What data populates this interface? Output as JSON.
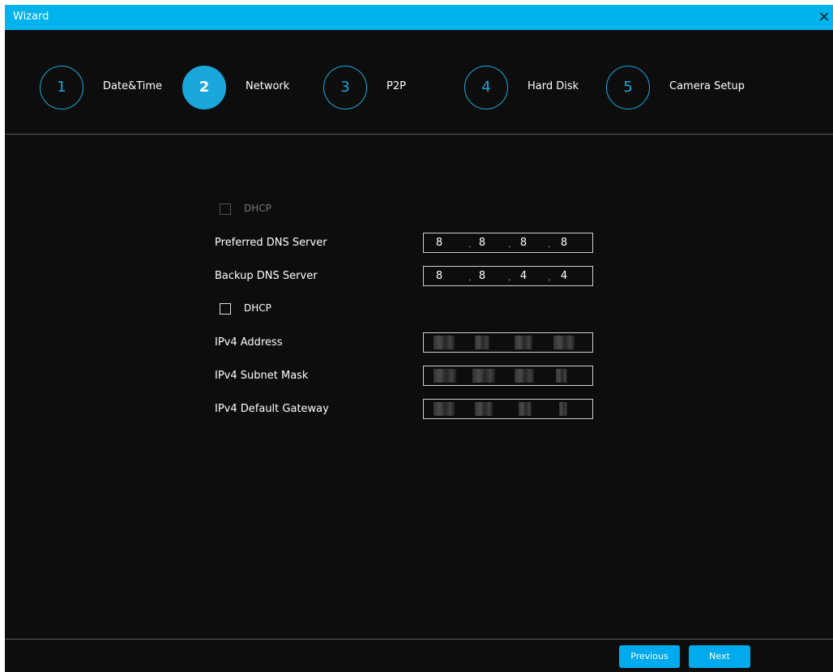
{
  "window": {
    "title": "Wizard",
    "close_glyph": "×"
  },
  "steps": [
    {
      "number": "1",
      "label": "Date&Time",
      "active": false
    },
    {
      "number": "2",
      "label": "Network",
      "active": true
    },
    {
      "number": "3",
      "label": "P2P",
      "active": false
    },
    {
      "number": "4",
      "label": "Hard Disk",
      "active": false
    },
    {
      "number": "5",
      "label": "Camera Setup",
      "active": false
    }
  ],
  "dns": {
    "dhcp_label": "DHCP",
    "dhcp_checked": false,
    "dhcp_disabled": true,
    "preferred_label": "Preferred DNS Server",
    "preferred": [
      "8",
      "8",
      "8",
      "8"
    ],
    "backup_label": "Backup DNS Server",
    "backup": [
      "8",
      "8",
      "4",
      "4"
    ]
  },
  "ipv4": {
    "dhcp_label": "DHCP",
    "dhcp_checked": false,
    "address_label": "IPv4 Address",
    "subnet_label": "IPv4 Subnet Mask",
    "gateway_label": "IPv4 Default Gateway"
  },
  "buttons": {
    "previous": "Previous",
    "next": "Next"
  },
  "colors": {
    "accent": "#00b3ec",
    "step_ring": "#1aa8dc",
    "background": "#0d0d0d"
  },
  "icons": {
    "close": "close-icon"
  }
}
